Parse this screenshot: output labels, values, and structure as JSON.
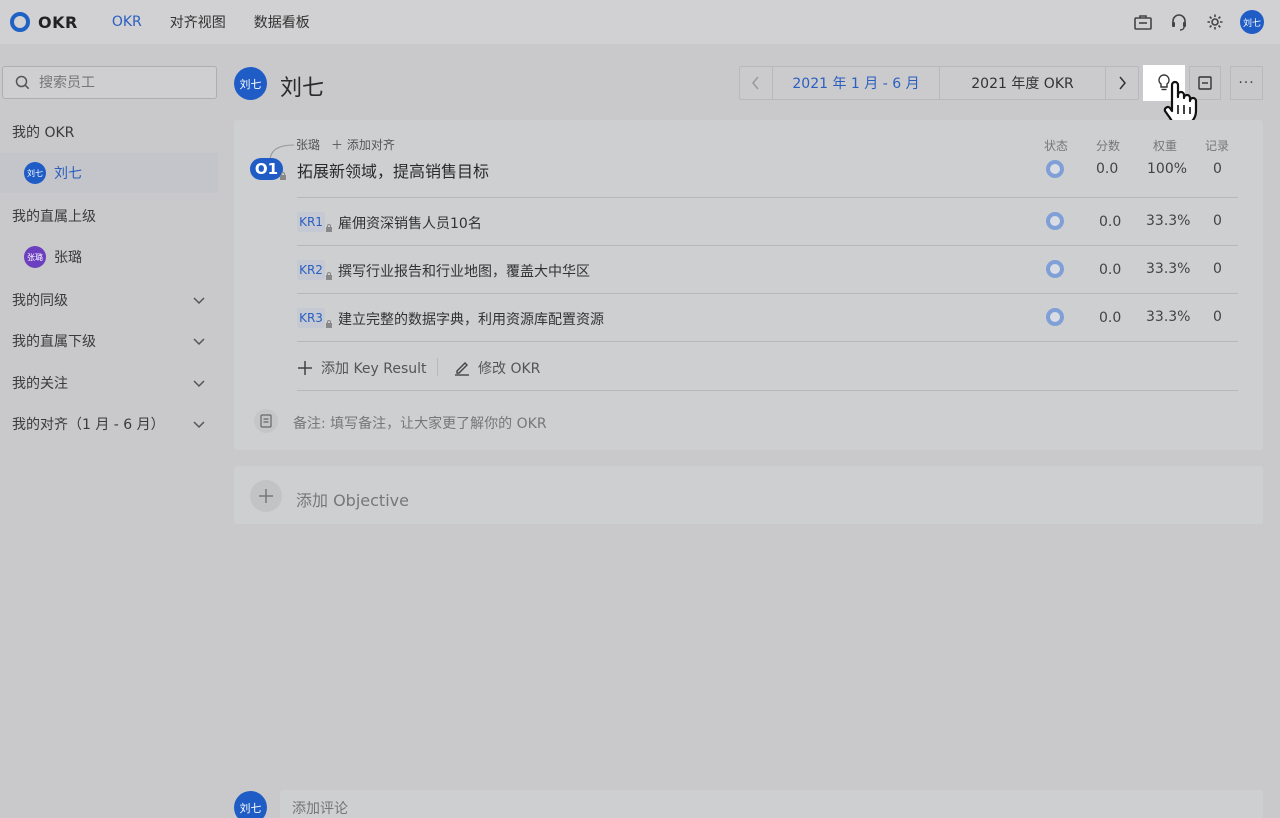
{
  "app": {
    "title": "OKR"
  },
  "nav": [
    {
      "label": "OKR",
      "active": true
    },
    {
      "label": "对齐视图",
      "active": false
    },
    {
      "label": "数据看板",
      "active": false
    }
  ],
  "top_right": {
    "icons": [
      "briefcase-icon",
      "headset-icon",
      "settings-icon"
    ],
    "avatar_text": "刘七"
  },
  "sidebar": {
    "search_placeholder": "搜索员工",
    "sections": [
      {
        "label": "我的 OKR"
      },
      {
        "label": "我的直属上级"
      },
      {
        "label": "我的同级",
        "collapsible": true
      },
      {
        "label": "我的直属下级",
        "collapsible": true
      },
      {
        "label": "我的关注",
        "collapsible": true
      },
      {
        "label": "我的对齐（1 月 - 6 月）",
        "collapsible": true
      }
    ],
    "people": [
      {
        "avatar": "刘七",
        "name": "刘七",
        "active": true
      },
      {
        "avatar": "张璐",
        "name": "张璐",
        "active": false
      }
    ]
  },
  "header": {
    "user_avatar": "刘七",
    "user_name": "刘七",
    "period_range": "2021 年 1 月 - 6 月",
    "period_cycle": "2021 年度 OKR",
    "more": "···"
  },
  "objective": {
    "aligned_to": "张璐",
    "add_align": "添加对齐",
    "badge": "O1",
    "title": "拓展新领域，提高销售目标",
    "columns": [
      "状态",
      "分数",
      "权重",
      "记录"
    ],
    "score": "0.0",
    "weight": "100%",
    "records": "0",
    "key_results": [
      {
        "badge": "KR1",
        "title": "雇佣资深销售人员10名",
        "score": "0.0",
        "weight": "33.3%",
        "records": "0"
      },
      {
        "badge": "KR2",
        "title": "撰写行业报告和行业地图，覆盖大中华区",
        "score": "0.0",
        "weight": "33.3%",
        "records": "0"
      },
      {
        "badge": "KR3",
        "title": "建立完整的数据字典，利用资源库配置资源",
        "score": "0.0",
        "weight": "33.3%",
        "records": "0"
      }
    ],
    "add_kr": "添加 Key Result",
    "edit_okr": "修改 OKR",
    "note": "备注:  填写备注，让大家更了解你的 OKR"
  },
  "add_objective": "添加 Objective",
  "comment": {
    "avatar": "刘七",
    "placeholder": "添加评论"
  },
  "colors": {
    "accent": "#1f5cc6",
    "link": "#2a5fc0",
    "status_ring": "#7f9fd6"
  }
}
